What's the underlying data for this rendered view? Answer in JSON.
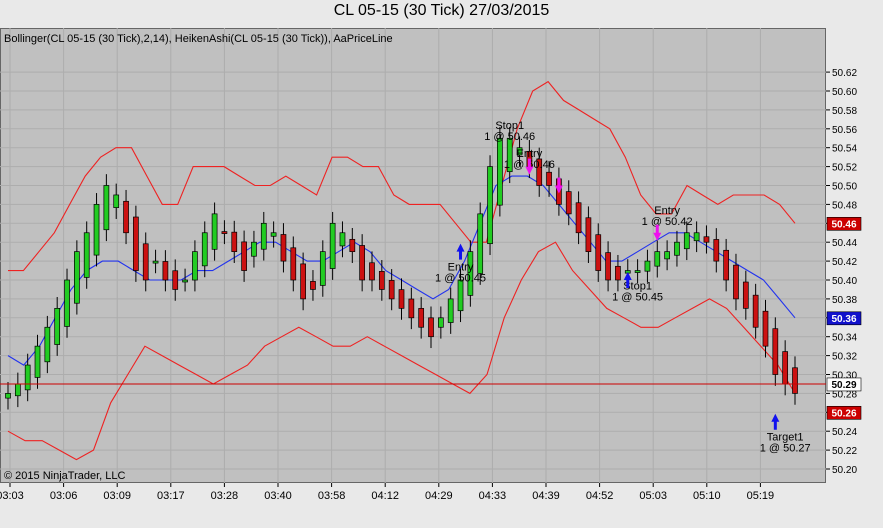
{
  "title": "CL 05-15 (30 Tick)  27/03/2015",
  "indicator_label": "Bollinger(CL 05-15 (30 Tick),2,14), HeikenAshi(CL 05-15 (30 Tick)), AaPriceLine",
  "copyright": "© 2015 NinjaTrader, LLC",
  "colors": {
    "up": "#22cc22",
    "down": "#cc1111",
    "upper_band": "#ee2222",
    "lower_band": "#ee2222",
    "middle_band": "#2233ee",
    "price_line": "#cc0000",
    "marker_long": "#1111ee",
    "marker_short": "#ee11ee"
  },
  "chart_data": {
    "type": "candlestick",
    "instrument": "CL 05-15 (30 Tick)",
    "date": "27/03/2015",
    "ylim": [
      50.19,
      50.63
    ],
    "y_ticks": [
      "50.62",
      "50.60",
      "50.58",
      "50.56",
      "50.54",
      "50.52",
      "50.50",
      "50.48",
      "50.46",
      "50.44",
      "50.42",
      "50.40",
      "50.38",
      "50.36",
      "50.34",
      "50.32",
      "50.30",
      "50.28",
      "50.26",
      "50.24",
      "50.22",
      "50.20"
    ],
    "x_ticks": [
      "03:03",
      "03:06",
      "03:09",
      "03:17",
      "03:28",
      "03:40",
      "03:58",
      "04:12",
      "04:29",
      "04:33",
      "04:39",
      "04:52",
      "05:03",
      "05:10",
      "05:19"
    ],
    "close_series": [
      50.28,
      50.29,
      50.31,
      50.33,
      50.35,
      50.37,
      50.4,
      50.43,
      50.45,
      50.48,
      50.5,
      50.49,
      50.45,
      50.41,
      50.4,
      50.42,
      50.4,
      50.39,
      50.4,
      50.43,
      50.45,
      50.47,
      50.45,
      50.43,
      50.41,
      50.44,
      50.46,
      50.45,
      50.42,
      50.4,
      50.38,
      50.39,
      50.43,
      50.46,
      50.45,
      50.43,
      50.4,
      50.4,
      50.39,
      50.38,
      50.37,
      50.36,
      50.35,
      50.34,
      50.36,
      50.38,
      50.4,
      50.43,
      50.47,
      50.52,
      50.55,
      50.55,
      50.54,
      50.52,
      50.5,
      50.5,
      50.48,
      50.47,
      50.45,
      50.43,
      50.41,
      50.4,
      50.4,
      50.41,
      50.41,
      50.42,
      50.43,
      50.43,
      50.44,
      50.45,
      50.45,
      50.44,
      50.42,
      50.4,
      50.38,
      50.37,
      50.35,
      50.33,
      50.3,
      50.29,
      50.28
    ],
    "upper_band": [
      50.41,
      50.41,
      50.43,
      50.45,
      50.48,
      50.51,
      50.53,
      50.54,
      50.54,
      50.51,
      50.48,
      50.48,
      50.52,
      50.52,
      50.52,
      50.51,
      50.5,
      50.5,
      50.51,
      50.5,
      50.49,
      50.53,
      50.53,
      50.52,
      50.52,
      50.49,
      50.48,
      50.48,
      50.48,
      50.46,
      50.44,
      50.44,
      50.5,
      50.56,
      50.6,
      50.61,
      50.59,
      50.58,
      50.57,
      50.56,
      50.53,
      50.49,
      50.47,
      50.47,
      50.5,
      50.49,
      50.48,
      50.49,
      50.49,
      50.49,
      50.48,
      50.46
    ],
    "middle_band": [
      50.32,
      50.31,
      50.33,
      50.36,
      50.39,
      50.41,
      50.42,
      50.42,
      50.41,
      50.4,
      50.4,
      50.4,
      50.41,
      50.41,
      50.42,
      50.43,
      50.44,
      50.44,
      50.43,
      50.42,
      50.42,
      50.43,
      50.44,
      50.43,
      50.41,
      50.4,
      50.39,
      50.38,
      50.39,
      50.42,
      50.46,
      50.5,
      50.51,
      50.51,
      50.5,
      50.48,
      50.46,
      50.44,
      50.42,
      50.42,
      50.43,
      50.44,
      50.45,
      50.45,
      50.44,
      50.43,
      50.42,
      50.41,
      50.4,
      50.38,
      50.36
    ],
    "lower_band": [
      50.24,
      50.23,
      50.23,
      50.22,
      50.21,
      50.22,
      50.27,
      50.3,
      50.33,
      50.32,
      50.31,
      50.3,
      50.29,
      50.3,
      50.31,
      50.33,
      50.34,
      50.35,
      50.34,
      50.33,
      50.33,
      50.34,
      50.33,
      50.32,
      50.31,
      50.3,
      50.29,
      50.28,
      50.3,
      50.36,
      50.4,
      50.43,
      50.44,
      50.41,
      50.39,
      50.37,
      50.36,
      50.35,
      50.35,
      50.36,
      50.37,
      50.38,
      50.37,
      50.35,
      50.33,
      50.31,
      50.28
    ],
    "price_line": {
      "value": 50.29,
      "label": "50.29"
    },
    "right_labels": [
      {
        "label": "50.46",
        "value": 50.46,
        "color": "#cc0000"
      },
      {
        "label": "50.36",
        "value": 50.36,
        "color": "#1111cc"
      },
      {
        "label": "50.29",
        "value": 50.29,
        "color": "#000000"
      },
      {
        "label": "50.26",
        "value": 50.26,
        "color": "#cc0000"
      }
    ],
    "annotations": [
      {
        "lines": [
          "Entry",
          "1 @ 50.45"
        ],
        "x_index": 46,
        "value": 50.41
      },
      {
        "lines": [
          "Stop1",
          "1 @ 50.46"
        ],
        "x_index": 51,
        "value": 50.56
      },
      {
        "lines": [
          "Entry",
          "1 @ 50.46"
        ],
        "x_index": 53,
        "value": 50.53
      },
      {
        "lines": [
          "Entry",
          "1 @ 50.42"
        ],
        "x_index": 67,
        "value": 50.47
      },
      {
        "lines": [
          "Stop1",
          "1 @ 50.45"
        ],
        "x_index": 64,
        "value": 50.39
      },
      {
        "lines": [
          "Target1",
          "1 @ 50.27"
        ],
        "x_index": 79,
        "value": 50.23
      }
    ]
  }
}
